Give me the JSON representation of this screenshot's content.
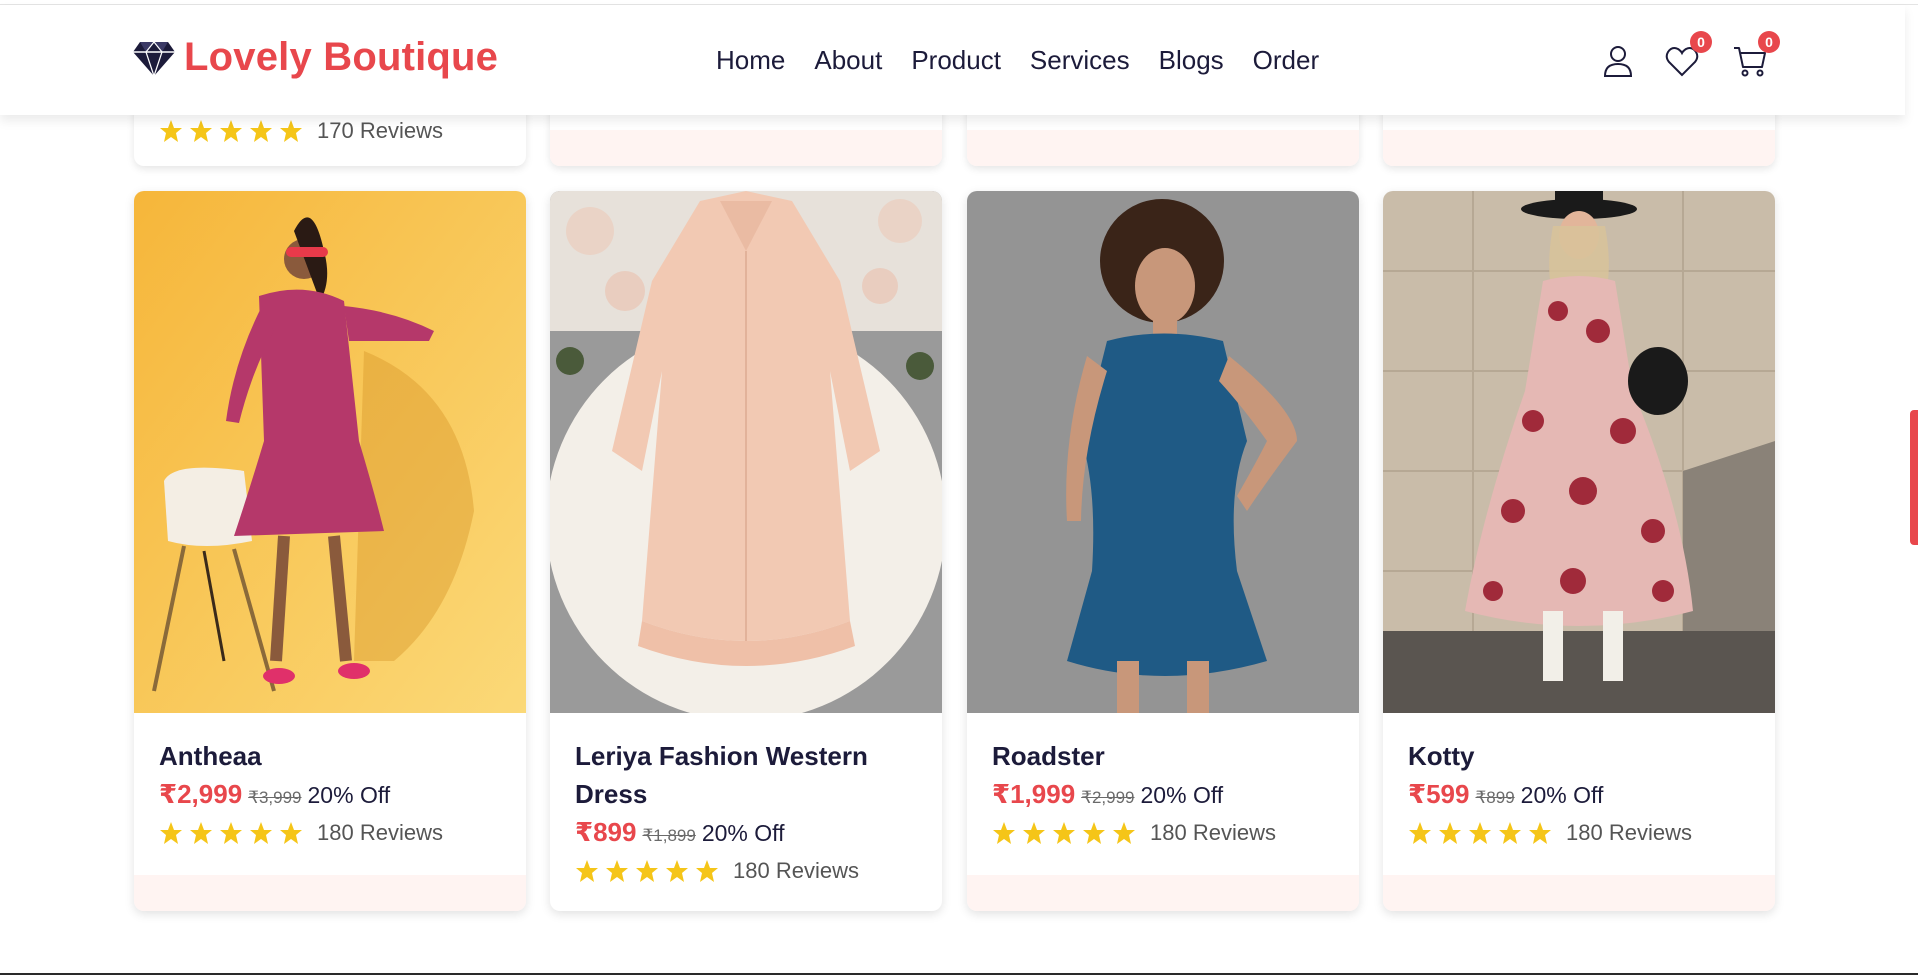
{
  "brand": {
    "name": "Lovely Boutique",
    "icon": "diamond-icon",
    "color": "#e8474c"
  },
  "nav": [
    "Home",
    "About",
    "Product",
    "Services",
    "Blogs",
    "Order"
  ],
  "header_icons": {
    "user": "user-icon",
    "wishlist": {
      "icon": "heart-icon",
      "count": "0"
    },
    "cart": {
      "icon": "cart-icon",
      "count": "0"
    }
  },
  "partial_row": {
    "reviews": "170 Reviews",
    "rating": 5
  },
  "products": [
    {
      "title": "Antheaa",
      "price": "₹2,999",
      "old_price": "₹3,999",
      "discount": "20% Off",
      "reviews": "180 Reviews",
      "rating": 5
    },
    {
      "title": "Leriya Fashion Western Dress",
      "price": "₹899",
      "old_price": "₹1,899",
      "discount": "20% Off",
      "reviews": "180 Reviews",
      "rating": 5
    },
    {
      "title": "Roadster",
      "price": "₹1,999",
      "old_price": "₹2,999",
      "discount": "20% Off",
      "reviews": "180 Reviews",
      "rating": 5
    },
    {
      "title": "Kotty",
      "price": "₹599",
      "old_price": "₹899",
      "discount": "20% Off",
      "reviews": "180 Reviews",
      "rating": 5
    }
  ],
  "colors": {
    "accent": "#e8474c",
    "text": "#1c1b3a",
    "star": "#f5c518",
    "strip": "#fff4f2"
  }
}
